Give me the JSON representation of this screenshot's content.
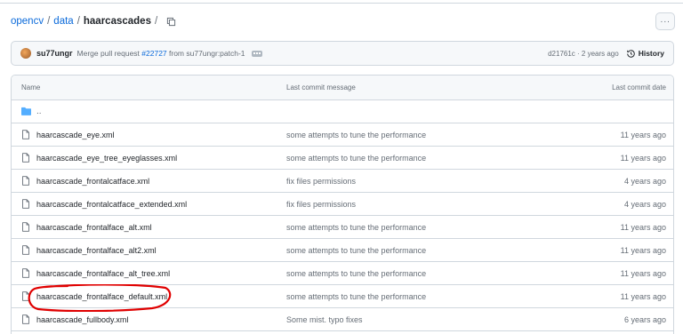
{
  "breadcrumb": {
    "repo": "opencv",
    "folder": "data",
    "current": "haarcascades",
    "trailing_slash": "/"
  },
  "more_label": "···",
  "commit": {
    "author": "su77ungr",
    "message_prefix": "Merge pull request ",
    "pr": "#22727",
    "message_suffix": " from su77ungr:patch-1",
    "sha_date": "d21761c · 2 years ago",
    "history_label": "History"
  },
  "table": {
    "headers": {
      "name": "Name",
      "message": "Last commit message",
      "date": "Last commit date"
    },
    "parent": "..",
    "rows": [
      {
        "name": "haarcascade_eye.xml",
        "message": "some attempts to tune the performance",
        "date": "11 years ago"
      },
      {
        "name": "haarcascade_eye_tree_eyeglasses.xml",
        "message": "some attempts to tune the performance",
        "date": "11 years ago"
      },
      {
        "name": "haarcascade_frontalcatface.xml",
        "message": "fix files permissions",
        "date": "4 years ago"
      },
      {
        "name": "haarcascade_frontalcatface_extended.xml",
        "message": "fix files permissions",
        "date": "4 years ago"
      },
      {
        "name": "haarcascade_frontalface_alt.xml",
        "message": "some attempts to tune the performance",
        "date": "11 years ago"
      },
      {
        "name": "haarcascade_frontalface_alt2.xml",
        "message": "some attempts to tune the performance",
        "date": "11 years ago"
      },
      {
        "name": "haarcascade_frontalface_alt_tree.xml",
        "message": "some attempts to tune the performance",
        "date": "11 years ago"
      },
      {
        "name": "haarcascade_frontalface_default.xml",
        "message": "some attempts to tune the performance",
        "date": "11 years ago"
      },
      {
        "name": "haarcascade_fullbody.xml",
        "message": "Some mist. typo fixes",
        "date": "6 years ago"
      }
    ]
  },
  "colors": {
    "link": "#0969da",
    "muted": "#656d76",
    "folder": "#54aeff",
    "annotation": "#e00000"
  },
  "icons": {
    "copy": "copy-icon",
    "history": "history-icon",
    "folder": "folder-icon",
    "file": "file-icon"
  }
}
